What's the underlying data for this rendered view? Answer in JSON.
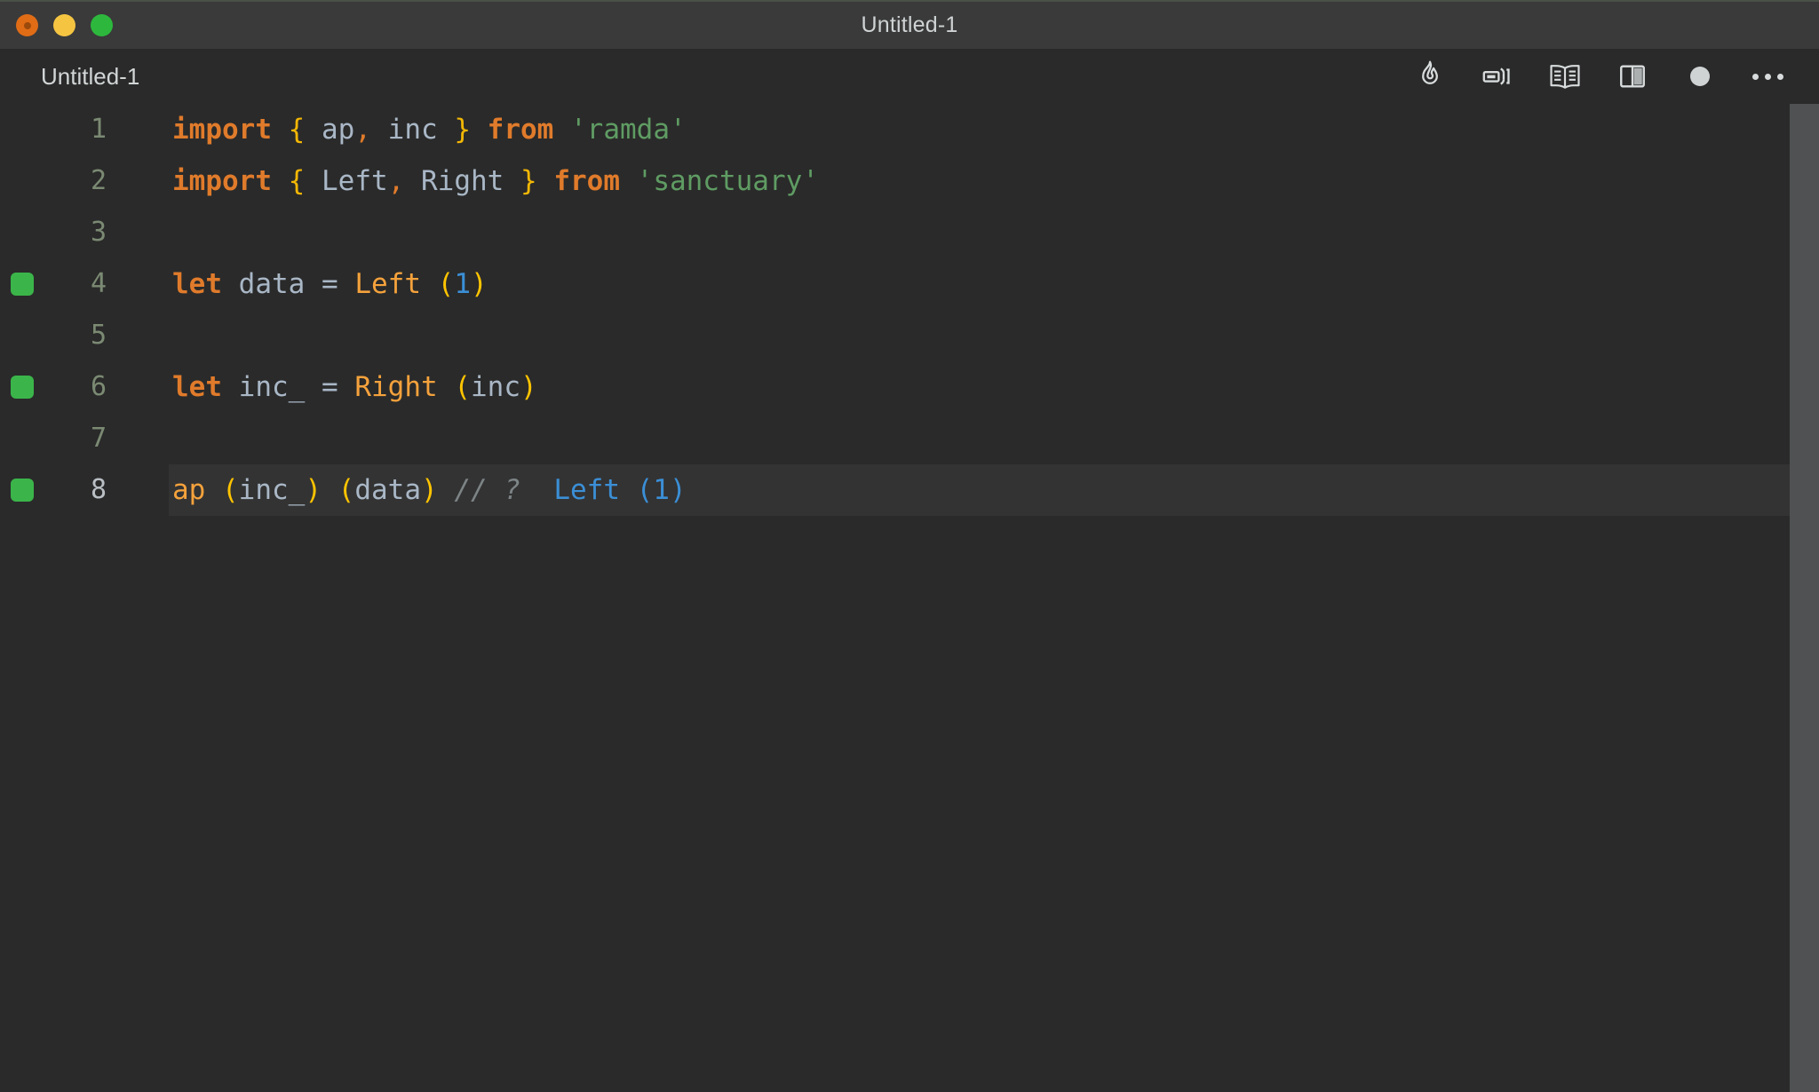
{
  "window": {
    "title": "Untitled-1",
    "traffic_lights": [
      {
        "name": "close",
        "color": "#e06c16"
      },
      {
        "name": "minimize",
        "color": "#f5c542"
      },
      {
        "name": "maximize",
        "color": "#2db83d"
      }
    ]
  },
  "tabbar": {
    "tab_label": "Untitled-1",
    "actions": [
      {
        "name": "quokka-flame-icon",
        "label": "Quokka"
      },
      {
        "name": "run-code-icon",
        "label": "Run Code"
      },
      {
        "name": "open-preview-icon",
        "label": "Open Preview"
      },
      {
        "name": "split-editor-icon",
        "label": "Split Editor Right"
      },
      {
        "name": "unsaved-indicator-icon",
        "label": "Unsaved changes"
      },
      {
        "name": "more-actions-icon",
        "label": "More Actions..."
      }
    ]
  },
  "editor": {
    "active_line": 8,
    "gutter_marker_color": "#3bb54a",
    "active_line_bg": "#333333",
    "lines": [
      {
        "number": "1",
        "marker": false,
        "active": false,
        "tokens": [
          {
            "t": "import",
            "c": "t-kw"
          },
          {
            "t": " ",
            "c": "t-ident"
          },
          {
            "t": "{",
            "c": "t-brace"
          },
          {
            "t": " ap",
            "c": "t-ident"
          },
          {
            "t": ",",
            "c": "t-punct"
          },
          {
            "t": " inc ",
            "c": "t-ident"
          },
          {
            "t": "}",
            "c": "t-brace"
          },
          {
            "t": " ",
            "c": "t-ident"
          },
          {
            "t": "from",
            "c": "t-kw"
          },
          {
            "t": " ",
            "c": "t-ident"
          },
          {
            "t": "'ramda'",
            "c": "t-string"
          }
        ]
      },
      {
        "number": "2",
        "marker": false,
        "active": false,
        "tokens": [
          {
            "t": "import",
            "c": "t-kw"
          },
          {
            "t": " ",
            "c": "t-ident"
          },
          {
            "t": "{",
            "c": "t-brace"
          },
          {
            "t": " Left",
            "c": "t-ident"
          },
          {
            "t": ",",
            "c": "t-punct"
          },
          {
            "t": " Right ",
            "c": "t-ident"
          },
          {
            "t": "}",
            "c": "t-brace"
          },
          {
            "t": " ",
            "c": "t-ident"
          },
          {
            "t": "from",
            "c": "t-kw"
          },
          {
            "t": " ",
            "c": "t-ident"
          },
          {
            "t": "'sanctuary'",
            "c": "t-string"
          }
        ]
      },
      {
        "number": "3",
        "marker": false,
        "active": false,
        "tokens": []
      },
      {
        "number": "4",
        "marker": true,
        "active": false,
        "tokens": [
          {
            "t": "let",
            "c": "t-kw"
          },
          {
            "t": " data ",
            "c": "t-ident"
          },
          {
            "t": "=",
            "c": "t-op"
          },
          {
            "t": " ",
            "c": "t-ident"
          },
          {
            "t": "Left",
            "c": "t-fn"
          },
          {
            "t": " ",
            "c": "t-ident"
          },
          {
            "t": "(",
            "c": "t-paren"
          },
          {
            "t": "1",
            "c": "t-num"
          },
          {
            "t": ")",
            "c": "t-paren"
          }
        ]
      },
      {
        "number": "5",
        "marker": false,
        "active": false,
        "tokens": []
      },
      {
        "number": "6",
        "marker": true,
        "active": false,
        "tokens": [
          {
            "t": "let",
            "c": "t-kw"
          },
          {
            "t": " inc_ ",
            "c": "t-ident"
          },
          {
            "t": "=",
            "c": "t-op"
          },
          {
            "t": " ",
            "c": "t-ident"
          },
          {
            "t": "Right",
            "c": "t-fn"
          },
          {
            "t": " ",
            "c": "t-ident"
          },
          {
            "t": "(",
            "c": "t-paren"
          },
          {
            "t": "inc",
            "c": "t-ident"
          },
          {
            "t": ")",
            "c": "t-paren"
          }
        ]
      },
      {
        "number": "7",
        "marker": false,
        "active": false,
        "tokens": []
      },
      {
        "number": "8",
        "marker": true,
        "active": true,
        "tokens": [
          {
            "t": "ap",
            "c": "t-fn"
          },
          {
            "t": " ",
            "c": "t-ident"
          },
          {
            "t": "(",
            "c": "t-paren"
          },
          {
            "t": "inc_",
            "c": "t-ident"
          },
          {
            "t": ")",
            "c": "t-paren"
          },
          {
            "t": " ",
            "c": "t-ident"
          },
          {
            "t": "(",
            "c": "t-paren"
          },
          {
            "t": "data",
            "c": "t-ident"
          },
          {
            "t": ")",
            "c": "t-paren"
          },
          {
            "t": " ",
            "c": "t-ident"
          },
          {
            "t": "// ?",
            "c": "t-comment"
          },
          {
            "t": "  ",
            "c": "t-ident"
          },
          {
            "t": "Left (1)",
            "c": "t-result"
          }
        ]
      }
    ],
    "blank_lines_after": 13
  }
}
